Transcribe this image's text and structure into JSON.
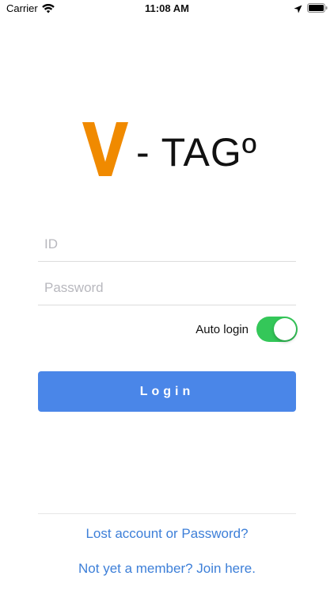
{
  "status_bar": {
    "carrier": "Carrier",
    "time": "11:08 AM",
    "icons": [
      "wifi-icon",
      "location-icon",
      "battery-icon"
    ]
  },
  "logo": {
    "letter": "V",
    "text": "- TAGº",
    "accent_color": "#f08a00"
  },
  "form": {
    "id_placeholder": "ID",
    "id_value": "",
    "password_placeholder": "Password",
    "password_value": "",
    "auto_login_label": "Auto login",
    "auto_login_on": true,
    "login_label": "Login"
  },
  "links": {
    "lost": "Lost account or Password?",
    "join": "Not yet a member? Join here."
  },
  "colors": {
    "button": "#4a86e8",
    "toggle_on": "#34c759",
    "link": "#3d7fd8"
  }
}
